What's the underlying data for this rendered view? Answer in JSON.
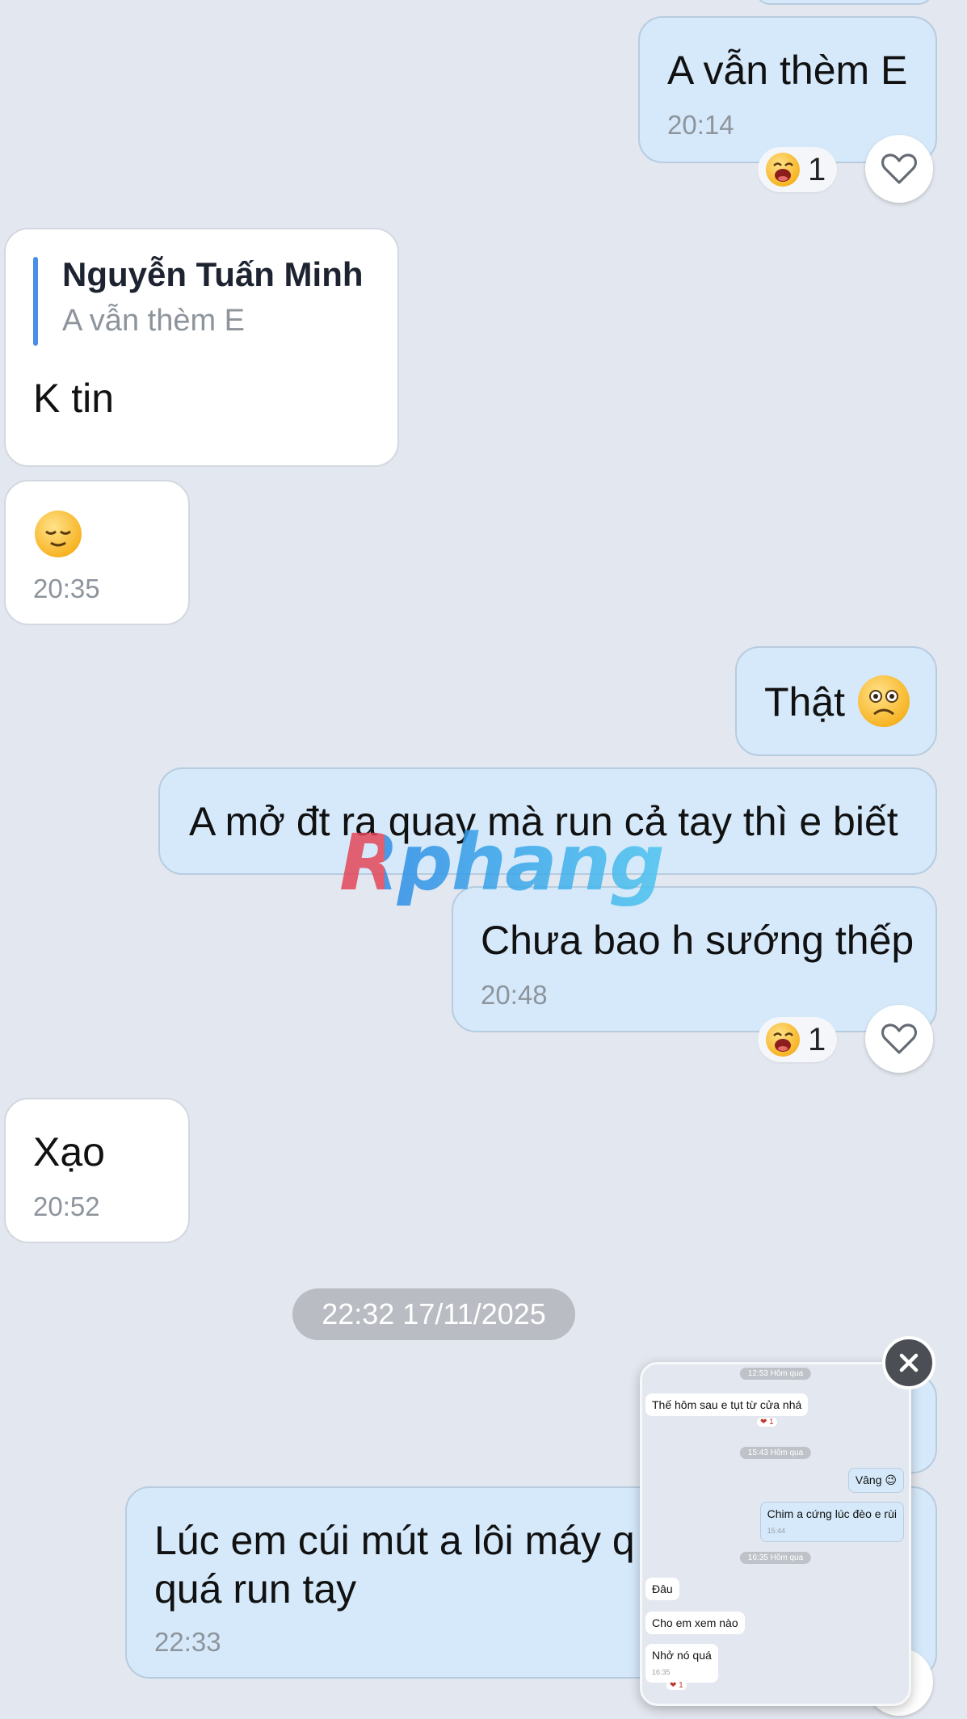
{
  "messages": [
    {
      "text": "A vẫn thèm E",
      "time": "20:14",
      "reaction_count": "1"
    },
    {
      "reply_to_name": "Nguyễn Tuấn Minh",
      "reply_to_text": "A vẫn thèm E",
      "text": "K tin"
    },
    {
      "emoji": "relieved-face",
      "time": "20:35"
    },
    {
      "text": "Thật",
      "emoji": "frowning-face"
    },
    {
      "text": "A mở đt ra quay mà run cả tay thì e biết"
    },
    {
      "text": "Chưa bao h sướng thếp",
      "time": "20:48",
      "reaction_count": "1"
    },
    {
      "text": "Xạo",
      "time": "20:52"
    },
    {
      "text_line1": "Lúc em cúi mút a lôi máy q",
      "text_line2": "quá run tay",
      "time": "22:33"
    }
  ],
  "date_separator": "22:32 17/11/2025",
  "watermark": "Rphang",
  "preview": {
    "items": [
      {
        "kind": "timestamp",
        "text": "12:53 Hôm qua"
      },
      {
        "kind": "in",
        "text": "Thế hôm sau e tụt từ cửa nhá",
        "reaction": "❤ 1"
      },
      {
        "kind": "timestamp",
        "text": "15:43 Hôm qua"
      },
      {
        "kind": "out",
        "text": "Vâng 😉"
      },
      {
        "kind": "out",
        "text": "Chim a cứng lúc đèo e rùi",
        "time": "15:44"
      },
      {
        "kind": "timestamp",
        "text": "16:35 Hôm qua"
      },
      {
        "kind": "in",
        "text": "Đâu"
      },
      {
        "kind": "in",
        "text": "Cho em xem nào"
      },
      {
        "kind": "in",
        "text": "Nhở nó quá",
        "time": "16:35",
        "reaction": "❤ 1"
      }
    ]
  },
  "icons": {
    "reaction": "laughing-face-icon",
    "heart": "heart-outline-icon",
    "close": "close-icon"
  },
  "colors": {
    "background": "#e3e7ef",
    "outgoing_bubble": "#d5e9fa",
    "incoming_bubble": "#ffffff",
    "reply_bar": "#4a8ee8",
    "time_text": "#8d949c",
    "date_pill": "#b9bcc2"
  }
}
